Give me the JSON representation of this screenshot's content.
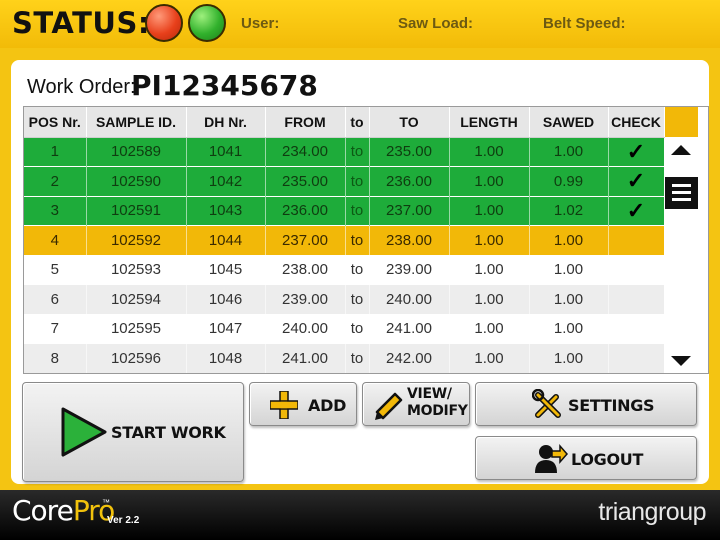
{
  "header": {
    "status_label": "STATUS:",
    "user_label": "User:",
    "saw_load_label": "Saw Load:",
    "belt_speed_label": "Belt Speed:",
    "status_lights": [
      {
        "name": "red",
        "color": "#e8401b"
      },
      {
        "name": "green",
        "color": "#31b12c"
      }
    ]
  },
  "work_order": {
    "label": "Work Order:",
    "value": "PI12345678"
  },
  "table": {
    "columns": [
      "POS Nr.",
      "SAMPLE ID.",
      "DH Nr.",
      "FROM",
      "to",
      "TO",
      "LENGTH",
      "SAWED",
      "CHECK"
    ],
    "rows": [
      {
        "pos": "1",
        "sample_id": "102589",
        "dh": "1041",
        "from": "234.00",
        "to_word": "to",
        "to": "235.00",
        "length": "1.00",
        "sawed": "1.00",
        "check": "✓",
        "state": "done"
      },
      {
        "pos": "2",
        "sample_id": "102590",
        "dh": "1042",
        "from": "235.00",
        "to_word": "to",
        "to": "236.00",
        "length": "1.00",
        "sawed": "0.99",
        "check": "✓",
        "state": "done"
      },
      {
        "pos": "3",
        "sample_id": "102591",
        "dh": "1043",
        "from": "236.00",
        "to_word": "to",
        "to": "237.00",
        "length": "1.00",
        "sawed": "1.02",
        "check": "✓",
        "state": "done"
      },
      {
        "pos": "4",
        "sample_id": "102592",
        "dh": "1044",
        "from": "237.00",
        "to_word": "to",
        "to": "238.00",
        "length": "1.00",
        "sawed": "1.00",
        "check": "",
        "state": "active"
      },
      {
        "pos": "5",
        "sample_id": "102593",
        "dh": "1045",
        "from": "238.00",
        "to_word": "to",
        "to": "239.00",
        "length": "1.00",
        "sawed": "1.00",
        "check": "",
        "state": "pending"
      },
      {
        "pos": "6",
        "sample_id": "102594",
        "dh": "1046",
        "from": "239.00",
        "to_word": "to",
        "to": "240.00",
        "length": "1.00",
        "sawed": "1.00",
        "check": "",
        "state": "pending"
      },
      {
        "pos": "7",
        "sample_id": "102595",
        "dh": "1047",
        "from": "240.00",
        "to_word": "to",
        "to": "241.00",
        "length": "1.00",
        "sawed": "1.00",
        "check": "",
        "state": "pending"
      },
      {
        "pos": "8",
        "sample_id": "102596",
        "dh": "1048",
        "from": "241.00",
        "to_word": "to",
        "to": "242.00",
        "length": "1.00",
        "sawed": "1.00",
        "check": "",
        "state": "pending"
      }
    ],
    "scroll_icons": [
      "arrow-up-icon",
      "list-handle-icon",
      "arrow-down-icon"
    ]
  },
  "buttons": {
    "start_work": "START WORK",
    "add": "ADD",
    "view_line1": "VIEW/",
    "view_line2": "MODIFY",
    "settings": "SETTINGS",
    "logout": "LOGOUT"
  },
  "footer": {
    "brand_core": "Core",
    "brand_pro": "Pro",
    "trademark": "™",
    "version": "Ver 2.2",
    "company": "triangroup"
  },
  "colors": {
    "accent_yellow": "#f2b808",
    "done_green": "#1eac3a",
    "footer_black": "#000000"
  }
}
